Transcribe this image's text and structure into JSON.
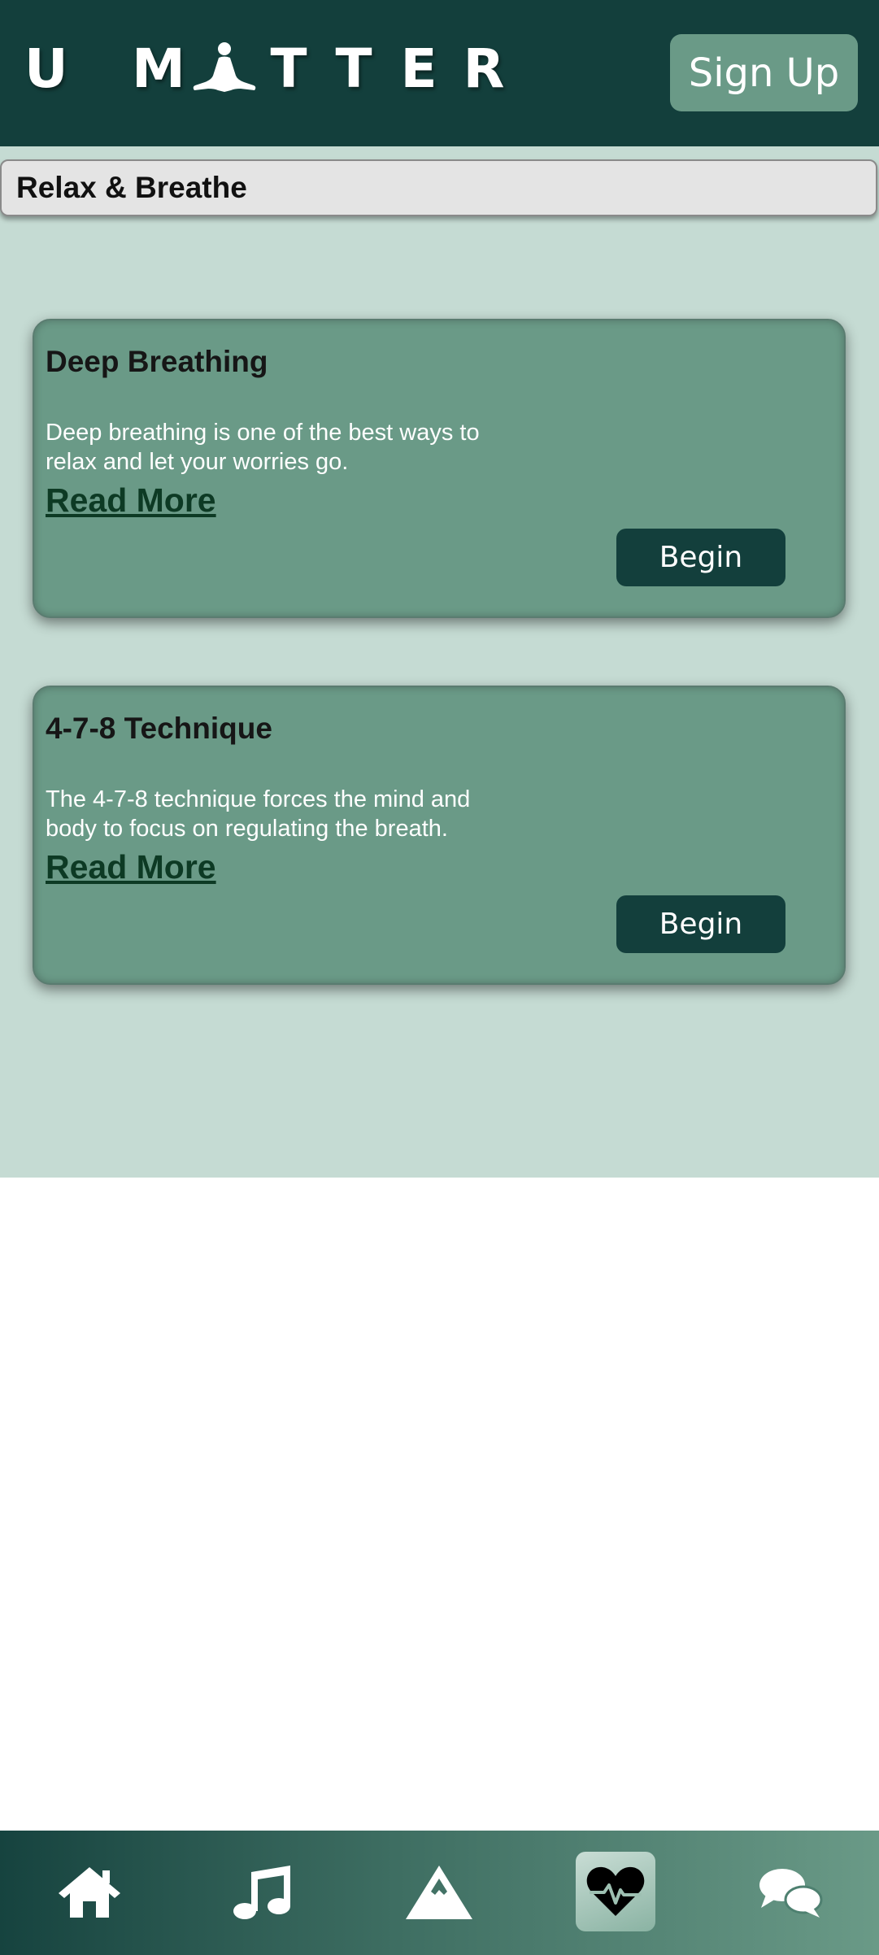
{
  "app": {
    "logo_letters": [
      "U",
      "M",
      "T",
      "T",
      "E",
      "R"
    ],
    "logo_icon": "meditation-figure-icon",
    "signup_label": "Sign Up"
  },
  "section": {
    "title": "Relax & Breathe"
  },
  "cards": [
    {
      "title": "Deep Breathing",
      "description": "Deep breathing is one of the best ways to relax and let your worries go.",
      "read_more": "Read More",
      "begin_label": "Begin"
    },
    {
      "title": "4-7-8 Technique",
      "description": "The 4-7-8 technique forces the mind and body to focus on regulating the breath.",
      "read_more": "Read More",
      "begin_label": "Begin"
    }
  ],
  "nav": {
    "items": [
      {
        "icon": "home-icon",
        "active": false
      },
      {
        "icon": "music-icon",
        "active": false
      },
      {
        "icon": "mountain-icon",
        "active": false
      },
      {
        "icon": "heart-pulse-icon",
        "active": true
      },
      {
        "icon": "chat-bubbles-icon",
        "active": false
      }
    ]
  },
  "colors": {
    "header_bg": "#133f3c",
    "accent": "#6a9a87",
    "content_bg": "#c5dbd3",
    "button_dark": "#133f3c",
    "link": "#0d3a24"
  }
}
